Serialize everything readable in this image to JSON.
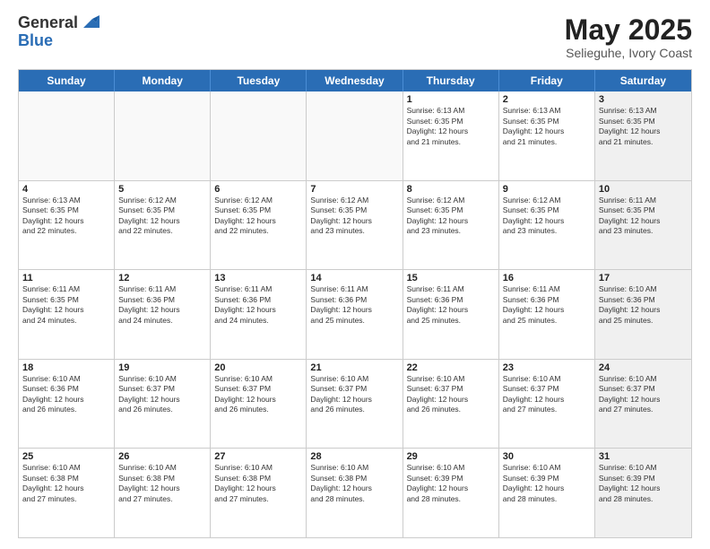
{
  "logo": {
    "general": "General",
    "blue": "Blue"
  },
  "title": "May 2025",
  "subtitle": "Selieguhe, Ivory Coast",
  "header_days": [
    "Sunday",
    "Monday",
    "Tuesday",
    "Wednesday",
    "Thursday",
    "Friday",
    "Saturday"
  ],
  "rows": [
    [
      {
        "day": "",
        "info": "",
        "empty": true
      },
      {
        "day": "",
        "info": "",
        "empty": true
      },
      {
        "day": "",
        "info": "",
        "empty": true
      },
      {
        "day": "",
        "info": "",
        "empty": true
      },
      {
        "day": "1",
        "info": "Sunrise: 6:13 AM\nSunset: 6:35 PM\nDaylight: 12 hours\nand 21 minutes.",
        "shaded": false
      },
      {
        "day": "2",
        "info": "Sunrise: 6:13 AM\nSunset: 6:35 PM\nDaylight: 12 hours\nand 21 minutes.",
        "shaded": false
      },
      {
        "day": "3",
        "info": "Sunrise: 6:13 AM\nSunset: 6:35 PM\nDaylight: 12 hours\nand 21 minutes.",
        "shaded": true
      }
    ],
    [
      {
        "day": "4",
        "info": "Sunrise: 6:13 AM\nSunset: 6:35 PM\nDaylight: 12 hours\nand 22 minutes.",
        "shaded": false
      },
      {
        "day": "5",
        "info": "Sunrise: 6:12 AM\nSunset: 6:35 PM\nDaylight: 12 hours\nand 22 minutes.",
        "shaded": false
      },
      {
        "day": "6",
        "info": "Sunrise: 6:12 AM\nSunset: 6:35 PM\nDaylight: 12 hours\nand 22 minutes.",
        "shaded": false
      },
      {
        "day": "7",
        "info": "Sunrise: 6:12 AM\nSunset: 6:35 PM\nDaylight: 12 hours\nand 23 minutes.",
        "shaded": false
      },
      {
        "day": "8",
        "info": "Sunrise: 6:12 AM\nSunset: 6:35 PM\nDaylight: 12 hours\nand 23 minutes.",
        "shaded": false
      },
      {
        "day": "9",
        "info": "Sunrise: 6:12 AM\nSunset: 6:35 PM\nDaylight: 12 hours\nand 23 minutes.",
        "shaded": false
      },
      {
        "day": "10",
        "info": "Sunrise: 6:11 AM\nSunset: 6:35 PM\nDaylight: 12 hours\nand 23 minutes.",
        "shaded": true
      }
    ],
    [
      {
        "day": "11",
        "info": "Sunrise: 6:11 AM\nSunset: 6:35 PM\nDaylight: 12 hours\nand 24 minutes.",
        "shaded": false
      },
      {
        "day": "12",
        "info": "Sunrise: 6:11 AM\nSunset: 6:36 PM\nDaylight: 12 hours\nand 24 minutes.",
        "shaded": false
      },
      {
        "day": "13",
        "info": "Sunrise: 6:11 AM\nSunset: 6:36 PM\nDaylight: 12 hours\nand 24 minutes.",
        "shaded": false
      },
      {
        "day": "14",
        "info": "Sunrise: 6:11 AM\nSunset: 6:36 PM\nDaylight: 12 hours\nand 25 minutes.",
        "shaded": false
      },
      {
        "day": "15",
        "info": "Sunrise: 6:11 AM\nSunset: 6:36 PM\nDaylight: 12 hours\nand 25 minutes.",
        "shaded": false
      },
      {
        "day": "16",
        "info": "Sunrise: 6:11 AM\nSunset: 6:36 PM\nDaylight: 12 hours\nand 25 minutes.",
        "shaded": false
      },
      {
        "day": "17",
        "info": "Sunrise: 6:10 AM\nSunset: 6:36 PM\nDaylight: 12 hours\nand 25 minutes.",
        "shaded": true
      }
    ],
    [
      {
        "day": "18",
        "info": "Sunrise: 6:10 AM\nSunset: 6:36 PM\nDaylight: 12 hours\nand 26 minutes.",
        "shaded": false
      },
      {
        "day": "19",
        "info": "Sunrise: 6:10 AM\nSunset: 6:37 PM\nDaylight: 12 hours\nand 26 minutes.",
        "shaded": false
      },
      {
        "day": "20",
        "info": "Sunrise: 6:10 AM\nSunset: 6:37 PM\nDaylight: 12 hours\nand 26 minutes.",
        "shaded": false
      },
      {
        "day": "21",
        "info": "Sunrise: 6:10 AM\nSunset: 6:37 PM\nDaylight: 12 hours\nand 26 minutes.",
        "shaded": false
      },
      {
        "day": "22",
        "info": "Sunrise: 6:10 AM\nSunset: 6:37 PM\nDaylight: 12 hours\nand 26 minutes.",
        "shaded": false
      },
      {
        "day": "23",
        "info": "Sunrise: 6:10 AM\nSunset: 6:37 PM\nDaylight: 12 hours\nand 27 minutes.",
        "shaded": false
      },
      {
        "day": "24",
        "info": "Sunrise: 6:10 AM\nSunset: 6:37 PM\nDaylight: 12 hours\nand 27 minutes.",
        "shaded": true
      }
    ],
    [
      {
        "day": "25",
        "info": "Sunrise: 6:10 AM\nSunset: 6:38 PM\nDaylight: 12 hours\nand 27 minutes.",
        "shaded": false
      },
      {
        "day": "26",
        "info": "Sunrise: 6:10 AM\nSunset: 6:38 PM\nDaylight: 12 hours\nand 27 minutes.",
        "shaded": false
      },
      {
        "day": "27",
        "info": "Sunrise: 6:10 AM\nSunset: 6:38 PM\nDaylight: 12 hours\nand 27 minutes.",
        "shaded": false
      },
      {
        "day": "28",
        "info": "Sunrise: 6:10 AM\nSunset: 6:38 PM\nDaylight: 12 hours\nand 28 minutes.",
        "shaded": false
      },
      {
        "day": "29",
        "info": "Sunrise: 6:10 AM\nSunset: 6:39 PM\nDaylight: 12 hours\nand 28 minutes.",
        "shaded": false
      },
      {
        "day": "30",
        "info": "Sunrise: 6:10 AM\nSunset: 6:39 PM\nDaylight: 12 hours\nand 28 minutes.",
        "shaded": false
      },
      {
        "day": "31",
        "info": "Sunrise: 6:10 AM\nSunset: 6:39 PM\nDaylight: 12 hours\nand 28 minutes.",
        "shaded": true
      }
    ]
  ]
}
